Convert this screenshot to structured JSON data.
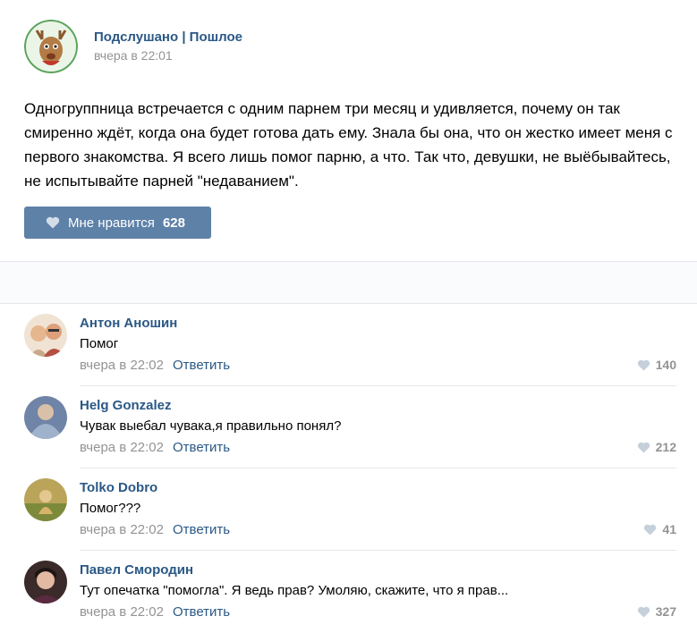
{
  "post": {
    "author": "Подслушано | Пошлое",
    "time": "вчера в 22:01",
    "text": "Одногруппница встречается с одним парнем три месяц и удивляется, почему он так смиренно ждёт, когда она будет готова дать ему. Знала бы она, что он жестко имеет меня с первого знакомства. Я всего лишь помог парню, а что. Так что, девушки, не выёбывайтесь, не испытывайте парней \"недаванием\".",
    "like_label": "Мне нравится",
    "like_count": "628"
  },
  "comments": [
    {
      "name": "Антон Аношин",
      "text": "Помог",
      "time": "вчера в 22:02",
      "reply": "Ответить",
      "likes": "140"
    },
    {
      "name": "Helg Gonzalez",
      "text": "Чувак выебал чувака,я правильно понял?",
      "time": "вчера в 22:02",
      "reply": "Ответить",
      "likes": "212"
    },
    {
      "name": "Tolko Dobro",
      "text": "Помог???",
      "time": "вчера в 22:02",
      "reply": "Ответить",
      "likes": "41"
    },
    {
      "name": "Павел Смородин",
      "text": "Тут опечатка \"помогла\". Я ведь прав? Умоляю, скажите, что я прав...",
      "time": "вчера в 22:02",
      "reply": "Ответить",
      "likes": "327"
    }
  ],
  "colors": {
    "link": "#2a5885",
    "button": "#5e81a8",
    "muted": "#939393"
  }
}
